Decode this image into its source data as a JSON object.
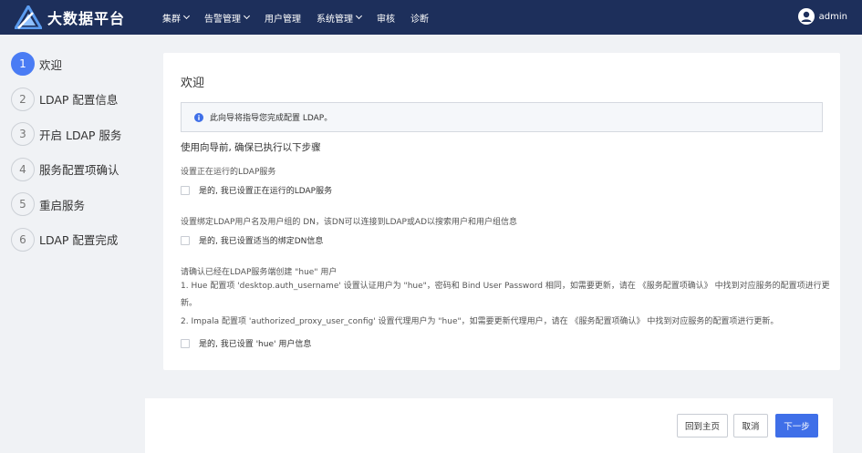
{
  "app": {
    "title": "大数据平台"
  },
  "nav": [
    {
      "label": "集群",
      "dropdown": true
    },
    {
      "label": "告警管理",
      "dropdown": true
    },
    {
      "label": "用户管理",
      "dropdown": false
    },
    {
      "label": "系统管理",
      "dropdown": true
    },
    {
      "label": "审核",
      "dropdown": false
    },
    {
      "label": "诊断",
      "dropdown": false
    }
  ],
  "user": {
    "name": "admin"
  },
  "steps": [
    {
      "num": "1",
      "label": "欢迎",
      "active": true
    },
    {
      "num": "2",
      "label": "LDAP 配置信息",
      "active": false
    },
    {
      "num": "3",
      "label": "开启 LDAP 服务",
      "active": false
    },
    {
      "num": "4",
      "label": "服务配置项确认",
      "active": false
    },
    {
      "num": "5",
      "label": "重启服务",
      "active": false
    },
    {
      "num": "6",
      "label": "LDAP 配置完成",
      "active": false
    }
  ],
  "card": {
    "title": "欢迎",
    "alert": "此向导将指导您完成配置 LDAP。",
    "section_head": "使用向导前, 确保已执行以下步骤",
    "req1": "设置正在运行的LDAP服务",
    "check1": "是的, 我已设置正在运行的LDAP服务",
    "req2": "设置绑定LDAP用户名及用户组的 DN，该DN可以连接到LDAP或AD以搜索用户和用户组信息",
    "check2": "是的, 我已设置适当的绑定DN信息",
    "req3": "请确认已经在LDAP服务端创建 \"hue\" 用户",
    "note1": "1. Hue 配置项 'desktop.auth_username' 设置认证用户为 \"hue\"，密码和 Bind User Password 相同，如需要更新，请在 《服务配置项确认》 中找到对应服务的配置项进行更新。",
    "note2": "2. Impala 配置项 'authorized_proxy_user_config' 设置代理用户为 \"hue\"，如需要更新代理用户，请在 《服务配置项确认》 中找到对应服务的配置项进行更新。",
    "check3": "是的, 我已设置 'hue' 用户信息"
  },
  "footer": {
    "home": "回到主页",
    "cancel": "取消",
    "next": "下一步"
  },
  "colors": {
    "topbar": "#1d2f5b",
    "accent": "#4a7cf4",
    "primary_button": "#3f6fe8",
    "background": "#f0f2f5"
  },
  "icons": [
    "logo-icon",
    "chevron-down-icon",
    "user-avatar-icon",
    "info-icon"
  ]
}
